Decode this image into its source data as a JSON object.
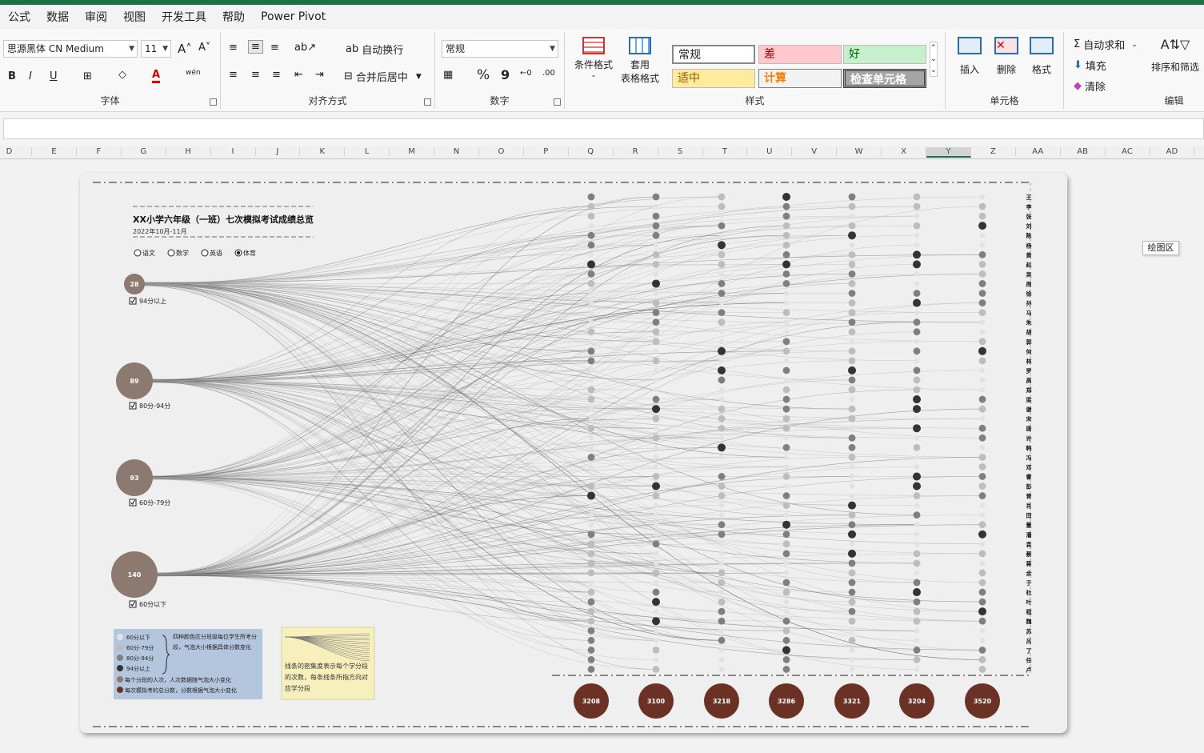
{
  "menu": {
    "items": [
      "公式",
      "数据",
      "审阅",
      "视图",
      "开发工具",
      "帮助",
      "Power Pivot"
    ]
  },
  "ribbon": {
    "font_name": "思源黑体 CN Medium",
    "font_size": "11",
    "font_group": "字体",
    "wrap_text": "自动换行",
    "merge_center": "合并后居中",
    "align_group": "对齐方式",
    "number_format": "常规",
    "number_group": "数字",
    "cond_format": "条件格式",
    "table_format_1": "套用",
    "table_format_2": "表格格式",
    "styles_group": "样式",
    "style_normal": "常规",
    "style_bad": "差",
    "style_good": "好",
    "style_neutral": "适中",
    "style_calc": "计算",
    "style_check": "检查单元格",
    "insert": "插入",
    "delete": "删除",
    "format": "格式",
    "cells_group": "单元格",
    "autosum": "自动求和",
    "fill": "填充",
    "clear": "清除",
    "sort_filter": "排序和筛选",
    "edit_group": "编辑"
  },
  "columns": [
    "D",
    "E",
    "F",
    "G",
    "H",
    "I",
    "J",
    "K",
    "L",
    "M",
    "N",
    "O",
    "P",
    "Q",
    "R",
    "S",
    "T",
    "U",
    "V",
    "W",
    "X",
    "Y",
    "Z",
    "AA",
    "AB",
    "AC",
    "AD"
  ],
  "selected_column": "Y",
  "plot_area_tag": "绘图区",
  "dashboard": {
    "title": "XX小学六年级（一班）七次模拟考试成绩总览",
    "subtitle": "2022年10月-11月",
    "subjects": [
      {
        "label": "语文",
        "selected": false
      },
      {
        "label": "数学",
        "selected": false
      },
      {
        "label": "英语",
        "selected": false
      },
      {
        "label": "体育",
        "selected": true
      }
    ],
    "bands": [
      {
        "count": "28",
        "label": "94分以上"
      },
      {
        "count": "89",
        "label": "80分-94分"
      },
      {
        "count": "93",
        "label": "60分-79分"
      },
      {
        "count": "140",
        "label": "60分以下"
      }
    ],
    "exam_totals": [
      "3208",
      "3100",
      "3218",
      "3286",
      "3321",
      "3204",
      "3520"
    ],
    "students": [
      "王",
      "李",
      "张",
      "刘",
      "陈",
      "杨",
      "黄",
      "赵",
      "吴",
      "周",
      "徐",
      "孙",
      "马",
      "朱",
      "胡",
      "郭",
      "何",
      "林",
      "罗",
      "高",
      "郑",
      "梁",
      "谢",
      "宋",
      "唐",
      "许",
      "韩",
      "冯",
      "邓",
      "曹",
      "彭",
      "曾",
      "肖",
      "田",
      "董",
      "潘",
      "袁",
      "蔡",
      "蒋",
      "余",
      "于",
      "杜",
      "叶",
      "程",
      "魏",
      "苏",
      "吕",
      "丁",
      "任",
      "卢"
    ],
    "legend_items": [
      "60分以下",
      "60分-79分",
      "80分-94分",
      "94分以上"
    ],
    "legend_desc": "四种颜色区分班级每位学生所考分段，气泡大小根据具体分数变化",
    "legend_note_1": "每个分段的人次，人次数据随气泡大小变化",
    "legend_note_2": "每次模拟考的总分数，分数根据气泡大小变化",
    "note_text": "线条的密集度表示每个学分段的次数，每条线条所指方向对应学分段"
  },
  "colors": {
    "excel_green": "#1e7145",
    "band_bubble": "#8c7a70",
    "total_bubble": "#6b3124",
    "legend_bg": "#b4c6de",
    "note_bg": "#f7f0bd"
  }
}
